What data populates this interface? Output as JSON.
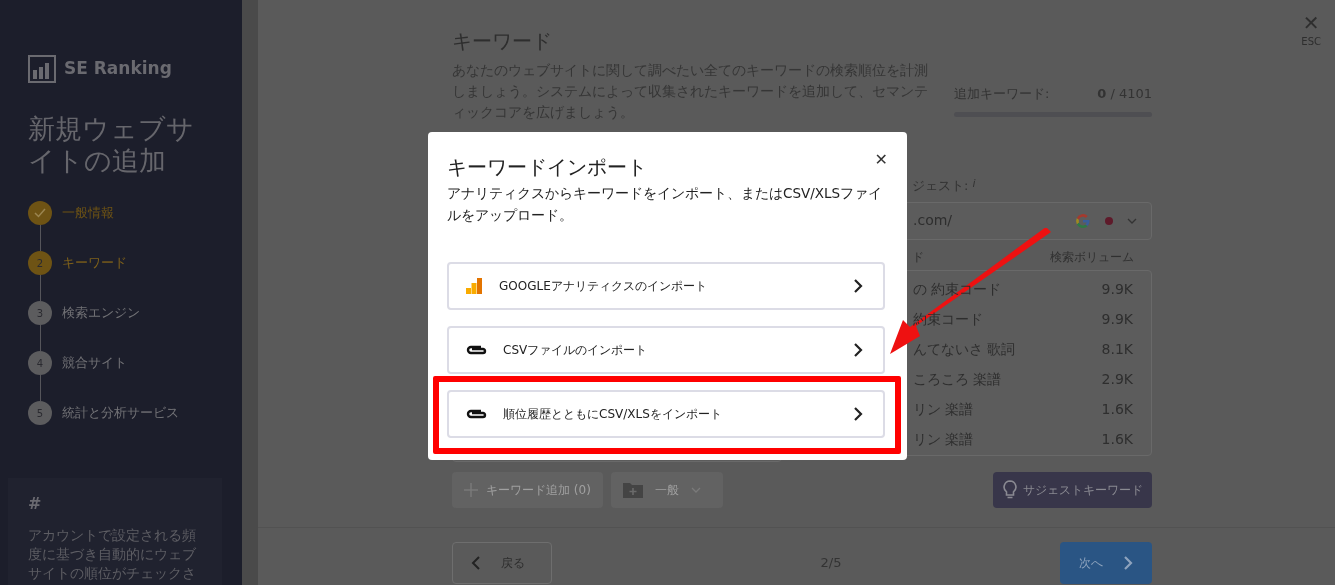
{
  "sidebar": {
    "brand": "SE Ranking",
    "title": "新規ウェブサイトの追加",
    "steps": [
      {
        "label": "一般情報",
        "completed": true,
        "selected": false
      },
      {
        "number": "2",
        "label": "キーワード",
        "completed": false,
        "selected": true
      },
      {
        "number": "3",
        "label": "検索エンジン",
        "completed": false,
        "selected": false
      },
      {
        "number": "4",
        "label": "競合サイト",
        "completed": false,
        "selected": false
      },
      {
        "number": "5",
        "label": "統計と分析サービス",
        "completed": false,
        "selected": false
      }
    ],
    "info": {
      "symbol": "#",
      "text": "アカウントで設定される頻度に基づき自動的にウェブサイトの順位がチェックさ"
    }
  },
  "close": {
    "symbol": "✕",
    "hint": "ESC"
  },
  "page": {
    "title": "キーワード",
    "description": "あなたのウェブサイトに関して調べたい全てのキーワードの検索順位を計測しましょう。システムによって収集されたキーワードを追加して、セマンティックコアを広げましょう。",
    "counter": {
      "label": "追加キーワード:",
      "count": "0",
      "total": "/ 4101",
      "level": 0
    }
  },
  "suggest": {
    "label": "ジェスト:",
    "info": "i",
    "site": ".com/",
    "columns": [
      "ド",
      "検索ボリューム"
    ],
    "rows": [
      {
        "keyword": "の 約束コード",
        "volume": "9.9K"
      },
      {
        "keyword": "約束コード",
        "volume": "9.9K"
      },
      {
        "keyword": "んてないさ 歌詞",
        "volume": "8.1K"
      },
      {
        "keyword": "ころころ 楽譜",
        "volume": "2.9K"
      },
      {
        "keyword": "リン 楽譜",
        "volume": "1.6K"
      },
      {
        "keyword": "リン 楽譜",
        "volume": "1.6K"
      }
    ],
    "button": "サジェストキーワード"
  },
  "toolbar": {
    "add": "キーワード追加 (0)",
    "group": "一般"
  },
  "footer": {
    "back": "戻る",
    "progress": "2/5",
    "next": "次へ"
  },
  "modal": {
    "title": "キーワードインポート",
    "description": "アナリティクスからキーワードをインポート、またはCSV/XLSファイルをアップロード。",
    "options": [
      {
        "kind": "analytics",
        "label": "GOOGLEアナリティクスのインポート",
        "highlighted": false
      },
      {
        "kind": "file",
        "label": "CSVファイルのインポート",
        "highlighted": false
      },
      {
        "kind": "file",
        "label": "順位履歴とともにCSV/XLSをインポート",
        "highlighted": true
      }
    ]
  }
}
